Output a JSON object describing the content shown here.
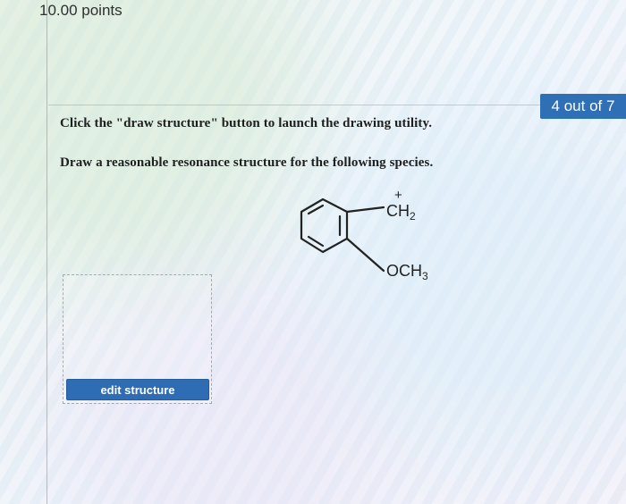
{
  "header": {
    "points": "10.00 points"
  },
  "question": {
    "progress": "4 out of 7",
    "instruction_1": "Click the \"draw structure\" button to launch the drawing utility.",
    "instruction_2": "Draw a reasonable resonance structure for the following species.",
    "structure": {
      "charge": "+",
      "ch2_main": "CH",
      "ch2_sub": "2",
      "och3_main": "OCH",
      "och3_sub": "3"
    },
    "edit_button_label": "edit structure"
  }
}
